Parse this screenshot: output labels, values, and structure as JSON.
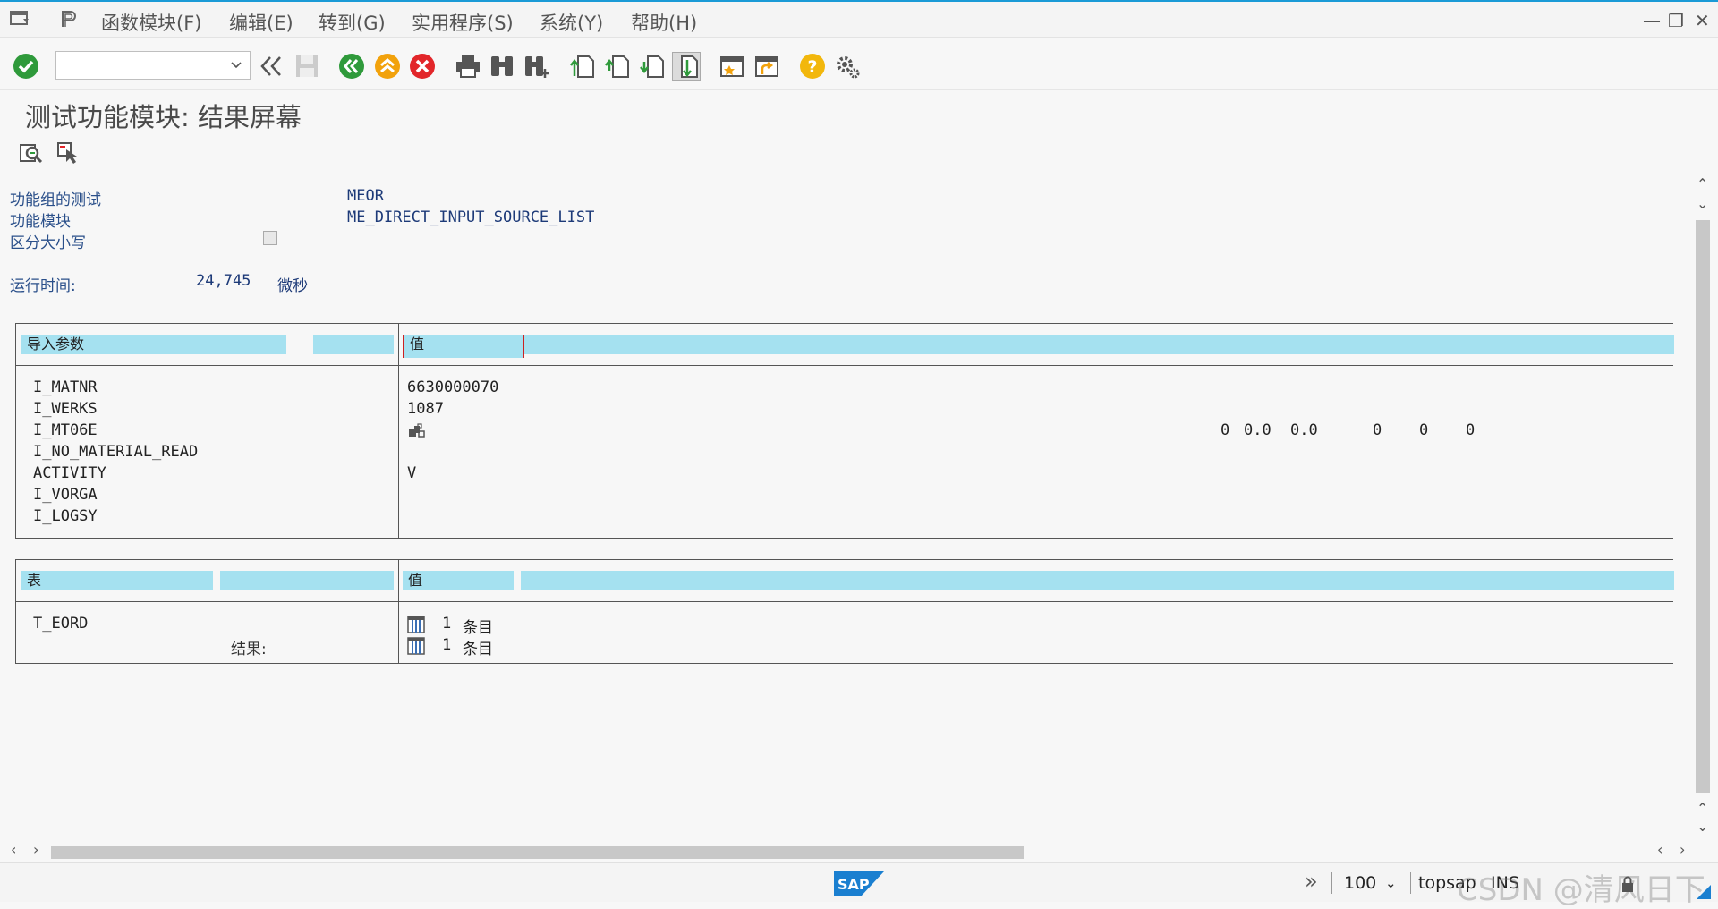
{
  "menu": {
    "items": [
      "函数模块(F)",
      "编辑(E)",
      "转到(G)",
      "实用程序(S)",
      "系统(Y)",
      "帮助(H)"
    ]
  },
  "window_controls": {
    "minimize": "—",
    "restore": "❐",
    "close": "✕"
  },
  "toolbar": {
    "command_value": "",
    "icons": [
      "check-icon",
      "back-double-chevron-icon",
      "save-icon",
      "back-icon",
      "exit-icon",
      "cancel-icon",
      "print-icon",
      "find-icon",
      "find-next-icon",
      "first-page-icon",
      "previous-page-icon",
      "next-page-icon",
      "last-page-icon",
      "new-session-icon",
      "shortcut-icon",
      "help-icon",
      "customize-layout-icon"
    ]
  },
  "title": "测试功能模块: 结果屏幕",
  "header_info": {
    "function_group_label": "功能组的测试",
    "function_group_value": "MEOR",
    "function_module_label": "功能模块",
    "function_module_value": "ME_DIRECT_INPUT_SOURCE_LIST",
    "case_sensitive_label": "区分大小写",
    "case_sensitive_checked": false,
    "runtime_label": "运行时间:",
    "runtime_value": "24,745",
    "runtime_unit": "微秒"
  },
  "import_params": {
    "header_param": "导入参数",
    "header_value": "值",
    "rows": [
      {
        "name": "I_MATNR",
        "value": "6630000070"
      },
      {
        "name": "I_WERKS",
        "value": "1087"
      },
      {
        "name": "I_MT06E",
        "value": ""
      },
      {
        "name": "I_NO_MATERIAL_READ",
        "value": ""
      },
      {
        "name": "ACTIVITY",
        "value": "V"
      },
      {
        "name": "I_VORGA",
        "value": ""
      },
      {
        "name": "I_LOGSY",
        "value": ""
      }
    ],
    "mt06e_extra": [
      "0",
      "0.0",
      "0.0",
      "0",
      "0",
      "0"
    ]
  },
  "tables": {
    "header_table": "表",
    "header_value": "值",
    "row_name": "T_EORD",
    "result_label": "结果:",
    "entries": [
      {
        "count": "1",
        "unit": "条目"
      },
      {
        "count": "1",
        "unit": "条目"
      }
    ]
  },
  "status": {
    "zoom": "100",
    "system": "topsap",
    "mode": "INS",
    "watermark": "CSDN @清风日下"
  },
  "colors": {
    "header_band": "#a5e1f0",
    "accent": "#1a9ad6",
    "ok_green": "#2f9a3b",
    "exit_orange": "#f2a20c",
    "cancel_red": "#e2262a"
  }
}
